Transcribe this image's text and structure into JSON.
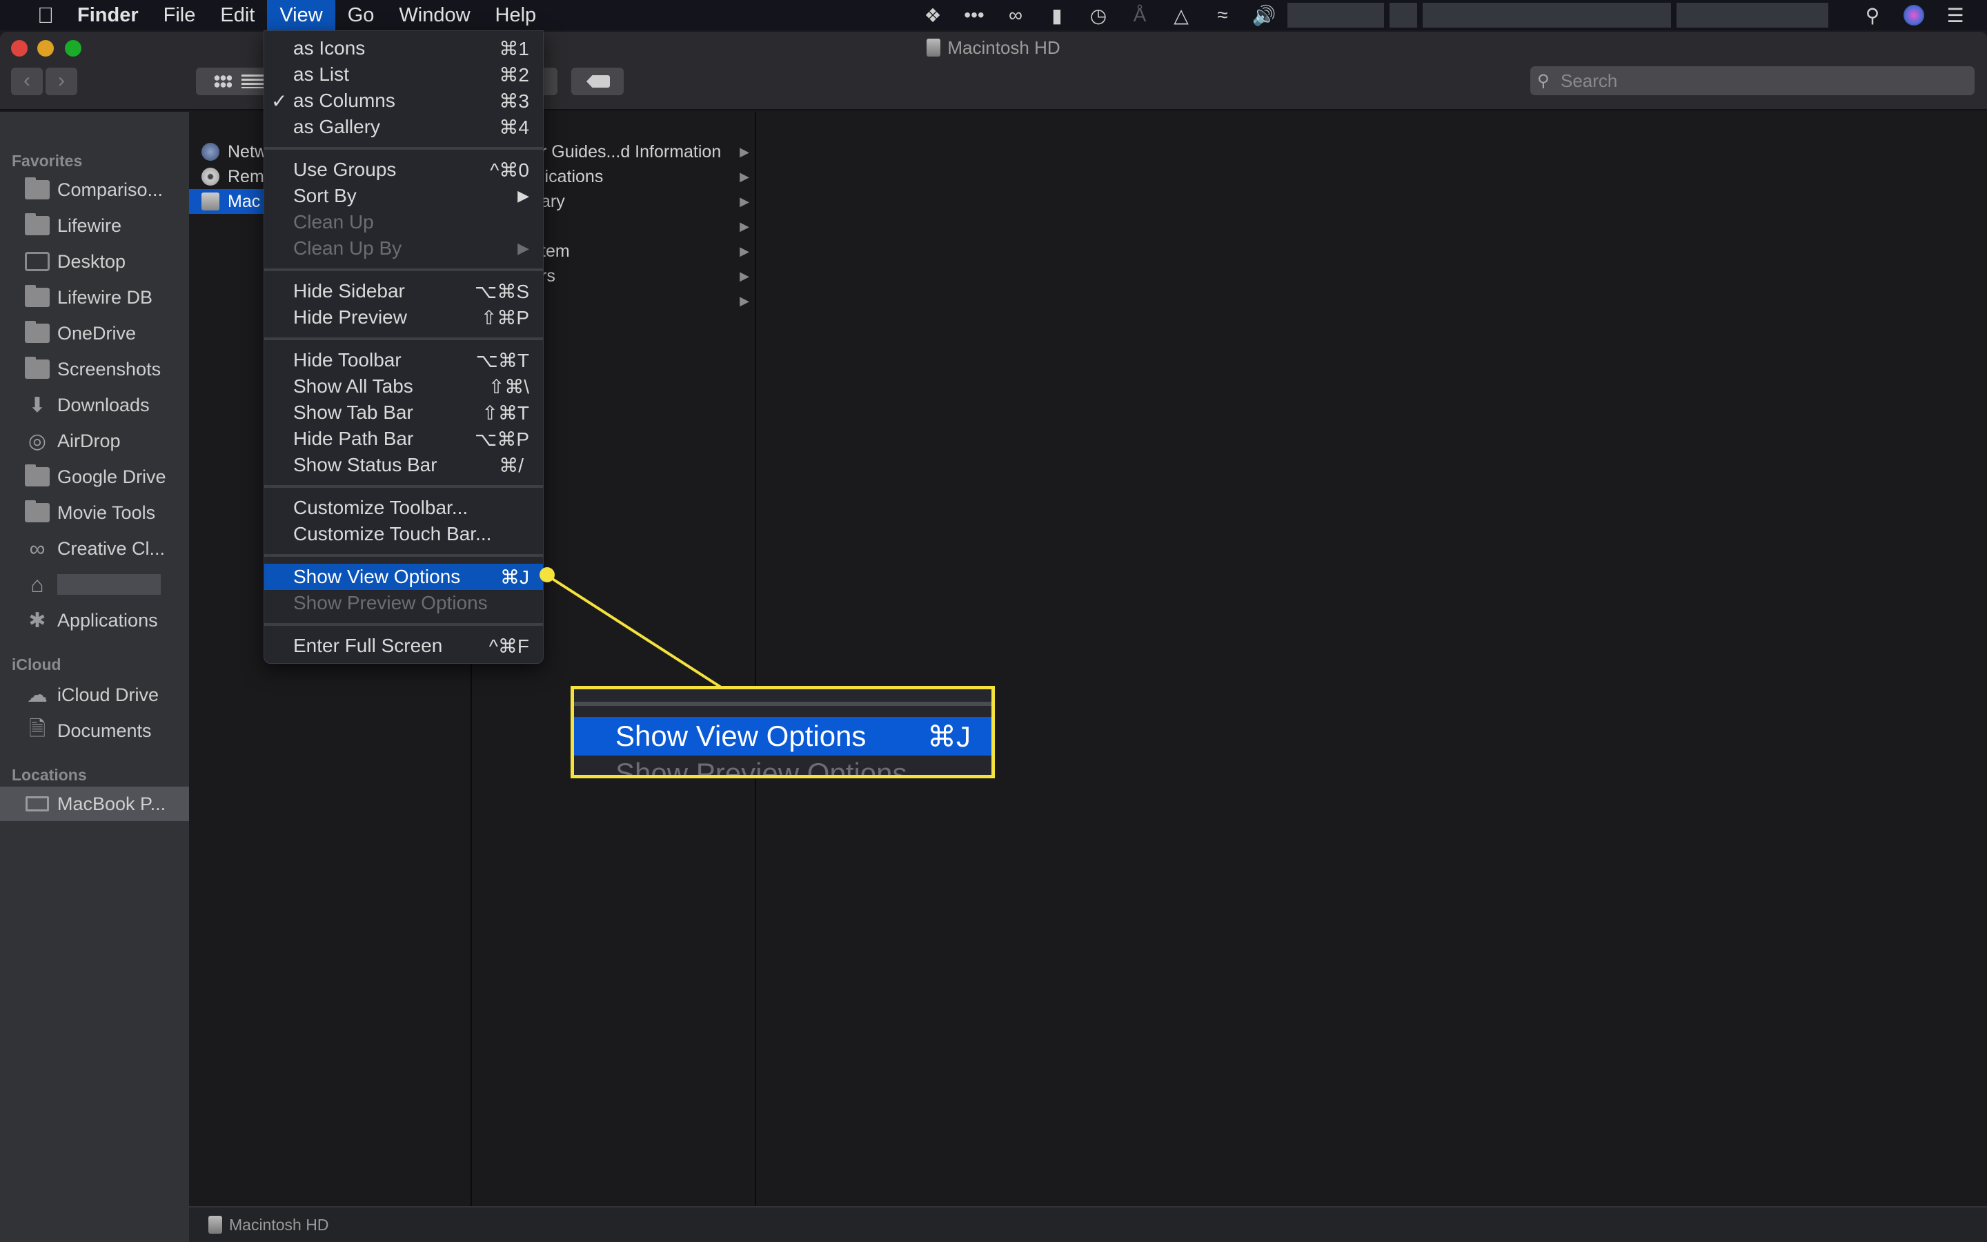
{
  "menubar": {
    "apple": "",
    "items": [
      "Finder",
      "File",
      "Edit",
      "View",
      "Go",
      "Window",
      "Help"
    ],
    "active": "View",
    "status_icons": [
      "dropbox-icon",
      "more-icon",
      "creative-cloud-icon",
      "notification-icon",
      "time-machine-icon",
      "bluetooth-icon",
      "airplay-icon",
      "wifi-icon",
      "volume-icon",
      "spotlight-icon",
      "siri-icon",
      "notification-center-icon"
    ]
  },
  "window": {
    "title": "Macintosh HD",
    "search_placeholder": "Search"
  },
  "sidebar": {
    "sections": [
      {
        "label": "Favorites",
        "items": [
          {
            "label": "Compariso...",
            "icon": "folder-icon"
          },
          {
            "label": "Lifewire",
            "icon": "folder-icon"
          },
          {
            "label": "Desktop",
            "icon": "desktop-icon"
          },
          {
            "label": "Lifewire DB",
            "icon": "folder-icon"
          },
          {
            "label": "OneDrive",
            "icon": "folder-icon"
          },
          {
            "label": "Screenshots",
            "icon": "folder-icon"
          },
          {
            "label": "Downloads",
            "icon": "downloads-icon"
          },
          {
            "label": "AirDrop",
            "icon": "airdrop-icon"
          },
          {
            "label": "Google Drive",
            "icon": "folder-icon"
          },
          {
            "label": "Movie Tools",
            "icon": "folder-icon"
          },
          {
            "label": "Creative Cl...",
            "icon": "creative-cloud-icon"
          },
          {
            "label": "",
            "icon": "home-icon"
          },
          {
            "label": "Applications",
            "icon": "applications-icon"
          }
        ]
      },
      {
        "label": "iCloud",
        "items": [
          {
            "label": "iCloud Drive",
            "icon": "cloud-icon"
          },
          {
            "label": "Documents",
            "icon": "documents-icon"
          }
        ]
      },
      {
        "label": "Locations",
        "items": [
          {
            "label": "MacBook P...",
            "icon": "laptop-icon"
          }
        ]
      }
    ]
  },
  "columns": {
    "col1": [
      "Netw",
      "Rem",
      "Mac"
    ],
    "col1_selected": 2,
    "col2": [
      "r Guides...d Information",
      "lications",
      "ary",
      "",
      "tem",
      "rs",
      ""
    ]
  },
  "view_menu": {
    "items": [
      {
        "label": "as Icons",
        "shortcut": "⌘1"
      },
      {
        "label": "as List",
        "shortcut": "⌘2"
      },
      {
        "label": "as Columns",
        "shortcut": "⌘3",
        "checked": "✓"
      },
      {
        "label": "as Gallery",
        "shortcut": "⌘4"
      },
      {
        "label": "Use Groups",
        "shortcut": "^⌘0"
      },
      {
        "label": "Sort By",
        "shortcut": "▶"
      },
      {
        "label": "Clean Up",
        "shortcut": "",
        "disabled": true
      },
      {
        "label": "Clean Up By",
        "shortcut": "▶",
        "disabled": true
      },
      {
        "label": "Hide Sidebar",
        "shortcut": "⌥⌘S"
      },
      {
        "label": "Hide Preview",
        "shortcut": "⇧⌘P"
      },
      {
        "label": "Hide Toolbar",
        "shortcut": "⌥⌘T"
      },
      {
        "label": "Show All Tabs",
        "shortcut": "⇧⌘\\"
      },
      {
        "label": "Show Tab Bar",
        "shortcut": "⇧⌘T"
      },
      {
        "label": "Hide Path Bar",
        "shortcut": "⌥⌘P"
      },
      {
        "label": "Show Status Bar",
        "shortcut": "⌘/"
      },
      {
        "label": "Customize Toolbar...",
        "shortcut": ""
      },
      {
        "label": "Customize Touch Bar...",
        "shortcut": ""
      },
      {
        "label": "Show View Options",
        "shortcut": "⌘J",
        "highlighted": true
      },
      {
        "label": "Show Preview Options",
        "shortcut": "",
        "disabled": true
      },
      {
        "label": "Enter Full Screen",
        "shortcut": "^⌘F"
      }
    ]
  },
  "callout": {
    "label": "Show View Options",
    "shortcut": "⌘J",
    "disabled_label": "Show Preview Options",
    "color": "#f5e23c"
  },
  "statusbar": {
    "path": "Macintosh HD"
  },
  "colors": {
    "accent": "#0a53b8",
    "highlight": "#f5e23c"
  }
}
